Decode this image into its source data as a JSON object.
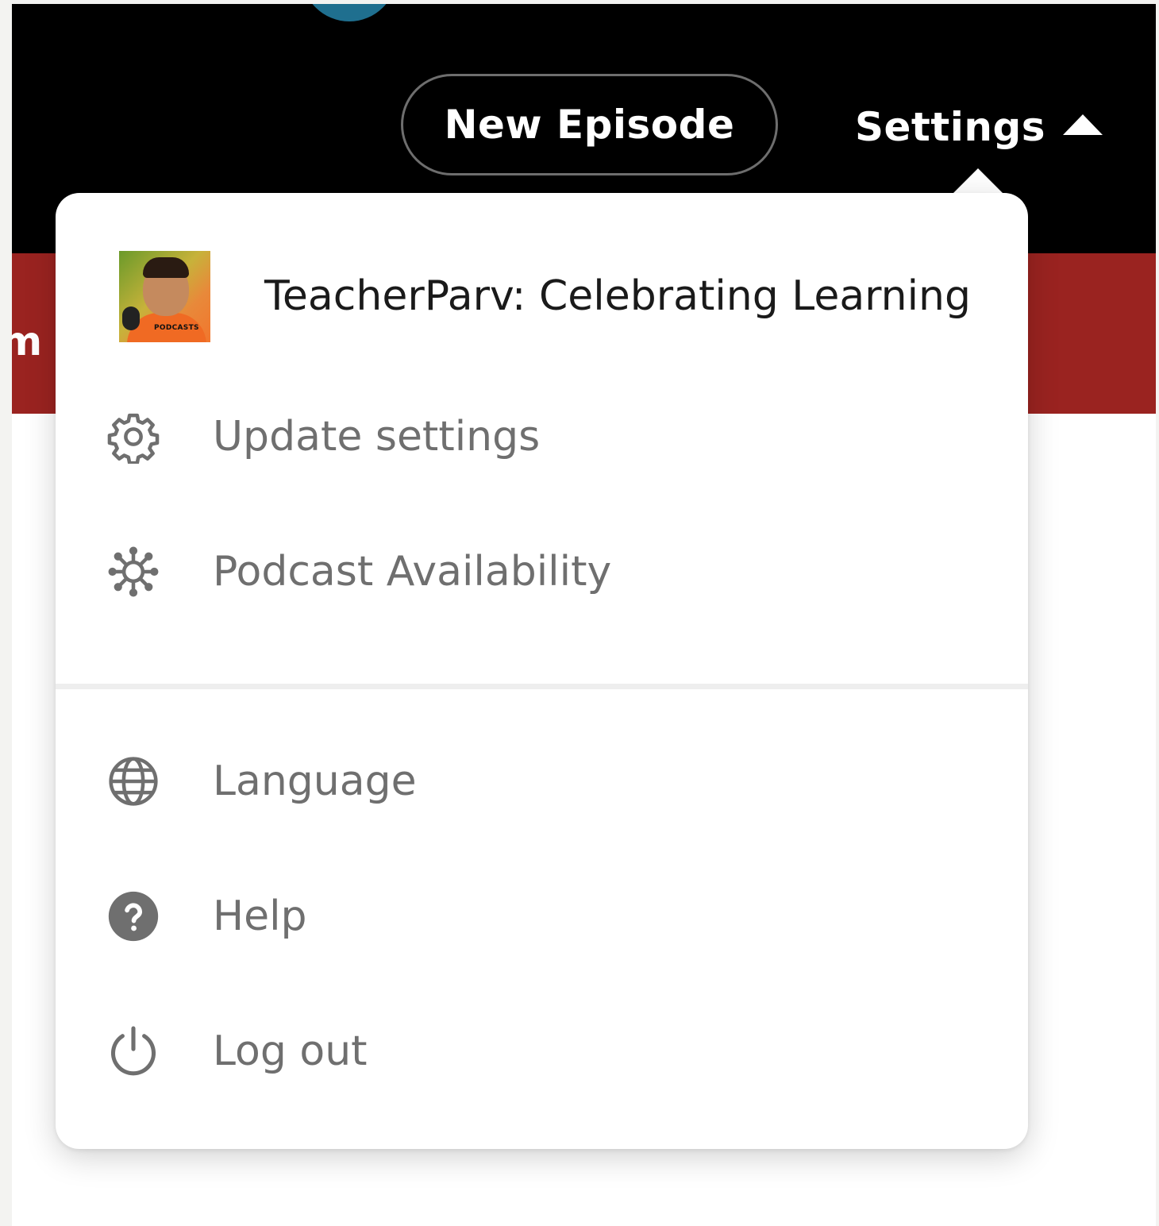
{
  "header": {
    "new_episode_label": "New Episode",
    "settings_label": "Settings",
    "partial_text": "m"
  },
  "dropdown": {
    "profile": {
      "name": "TeacherParv: Celebrating Learning",
      "avatar_caption": "PODCASTS"
    },
    "items": [
      {
        "label": "Update settings",
        "icon": "gear-icon"
      },
      {
        "label": "Podcast Availability",
        "icon": "network-hub-icon"
      },
      {
        "label": "Language",
        "icon": "globe-icon"
      },
      {
        "label": "Help",
        "icon": "help-circle-icon"
      },
      {
        "label": "Log out",
        "icon": "power-icon"
      }
    ]
  },
  "colors": {
    "topbar": "#000000",
    "band": "#9a2320",
    "menu_text": "#6f6f6f",
    "icon": "#6f6f6f"
  }
}
